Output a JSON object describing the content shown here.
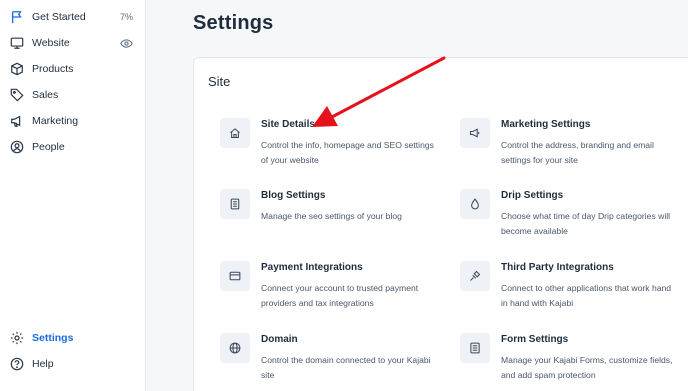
{
  "sidebar": {
    "items": [
      {
        "label": "Get Started",
        "icon": "flag-icon",
        "meta": "7%"
      },
      {
        "label": "Website",
        "icon": "monitor-icon",
        "meta_icon": "eye-icon"
      },
      {
        "label": "Products",
        "icon": "box-icon"
      },
      {
        "label": "Sales",
        "icon": "tag-icon"
      },
      {
        "label": "Marketing",
        "icon": "megaphone-icon"
      },
      {
        "label": "People",
        "icon": "person-circle-icon"
      }
    ],
    "bottom_items": [
      {
        "label": "Settings",
        "icon": "gear-icon",
        "active": true
      },
      {
        "label": "Help",
        "icon": "question-circle-icon"
      }
    ]
  },
  "page": {
    "title": "Settings"
  },
  "section": {
    "title": "Site",
    "settings": [
      {
        "title": "Site Details",
        "description": "Control the info, homepage and SEO settings of your website",
        "icon": "home-icon"
      },
      {
        "title": "Marketing Settings",
        "description": "Control the address, branding and email settings for your site",
        "icon": "megaphone-icon"
      },
      {
        "title": "Blog Settings",
        "description": "Manage the seo settings of your blog",
        "icon": "document-icon"
      },
      {
        "title": "Drip Settings",
        "description": "Choose what time of day Drip categories will become available",
        "icon": "droplet-icon"
      },
      {
        "title": "Payment Integrations",
        "description": "Connect your account to trusted payment providers and tax integrations",
        "icon": "credit-card-icon"
      },
      {
        "title": "Third Party Integrations",
        "description": "Connect to other applications that work hand in hand with Kajabi",
        "icon": "plug-icon"
      },
      {
        "title": "Domain",
        "description": "Control the domain connected to your Kajabi site",
        "icon": "globe-icon"
      },
      {
        "title": "Form Settings",
        "description": "Manage your Kajabi Forms, customize fields, and add spam protection",
        "icon": "form-icon"
      }
    ]
  },
  "colors": {
    "accent": "#1a6ae3",
    "annotation_arrow": "#e5111b",
    "tile_bg": "#eef1f5"
  }
}
